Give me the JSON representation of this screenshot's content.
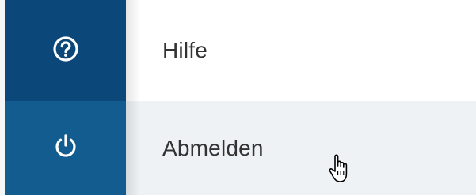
{
  "menu": {
    "items": [
      {
        "label": "Hilfe",
        "icon": "help-circle-icon"
      },
      {
        "label": "Abmelden",
        "icon": "power-icon",
        "state": "hovered"
      }
    ]
  },
  "colors": {
    "help_icon_bg": "#0b4778",
    "logout_icon_bg": "#135c8f",
    "hover_row_bg": "#eef2f5",
    "label_text": "#333333",
    "icon_fg": "#ffffff"
  },
  "cursor": {
    "icon": "hand-pointer-icon"
  }
}
